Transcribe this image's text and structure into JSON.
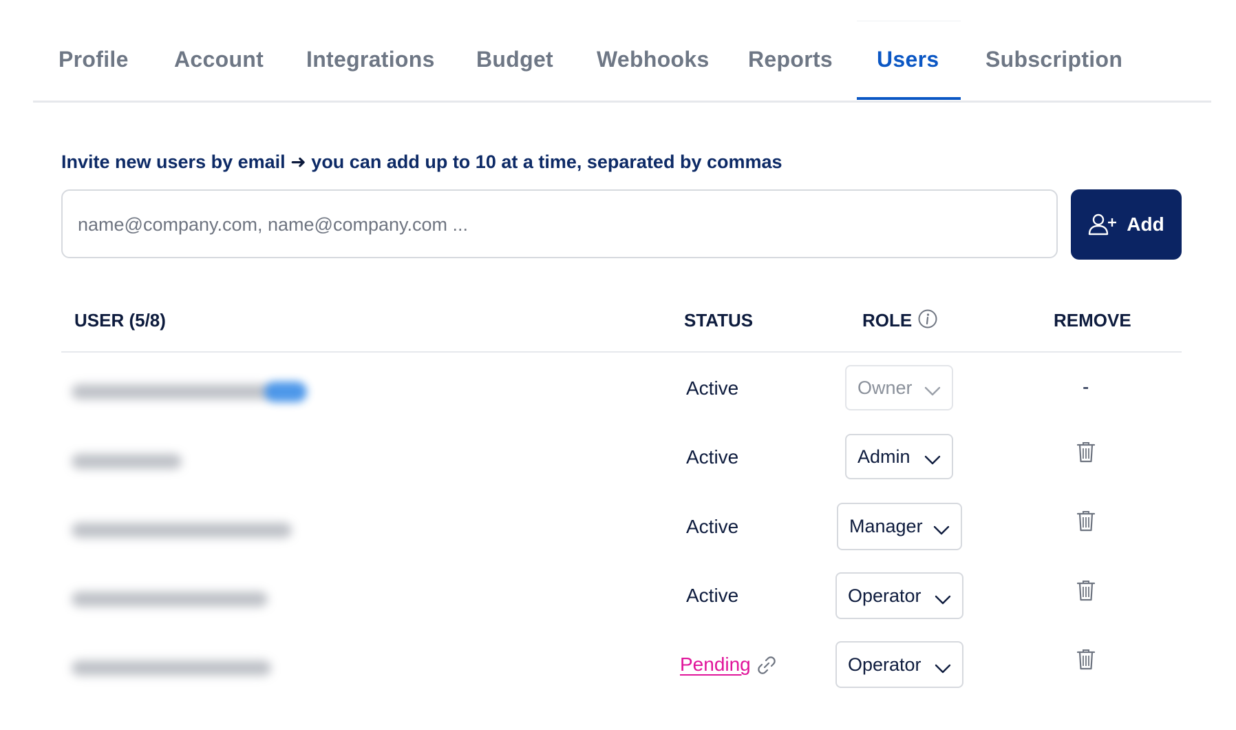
{
  "tabs": [
    {
      "label": "Profile",
      "active": false
    },
    {
      "label": "Account",
      "active": false
    },
    {
      "label": "Integrations",
      "active": false
    },
    {
      "label": "Budget",
      "active": false
    },
    {
      "label": "Webhooks",
      "active": false
    },
    {
      "label": "Reports",
      "active": false
    },
    {
      "label": "Users",
      "active": true
    },
    {
      "label": "Subscription",
      "active": false
    }
  ],
  "invite": {
    "label_before": "Invite new users by email",
    "arrow": "➜",
    "label_after": "you can add up to 10 at a time, separated by commas",
    "placeholder": "name@company.com, name@company.com ...",
    "value": "",
    "add_label": "Add",
    "add_icon": "user-plus-icon"
  },
  "table": {
    "headers": {
      "user": "USER (5/8)",
      "status": "STATUS",
      "role": "ROLE",
      "remove": "REMOVE"
    },
    "role_info_icon": "info-icon",
    "rows": [
      {
        "email": "(blurred)",
        "status": "Active",
        "role": "Owner",
        "role_editable": false,
        "remove": "-"
      },
      {
        "email": "(blurred)",
        "status": "Active",
        "role": "Admin",
        "role_editable": true,
        "remove": "trash-icon"
      },
      {
        "email": "(blurred)",
        "status": "Active",
        "role": "Manager",
        "role_editable": true,
        "remove": "trash-icon"
      },
      {
        "email": "(blurred)",
        "status": "Active",
        "role": "Operator",
        "role_editable": true,
        "remove": "trash-icon"
      },
      {
        "email": "(blurred)",
        "status": "Pending",
        "status_icon": "link-icon",
        "role": "Operator",
        "role_editable": true,
        "remove": "trash-icon"
      }
    ]
  },
  "colors": {
    "accent": "#0b57c4",
    "primary_button": "#0b2463",
    "pending": "#e0149a",
    "tab_inactive": "#6e7785"
  }
}
